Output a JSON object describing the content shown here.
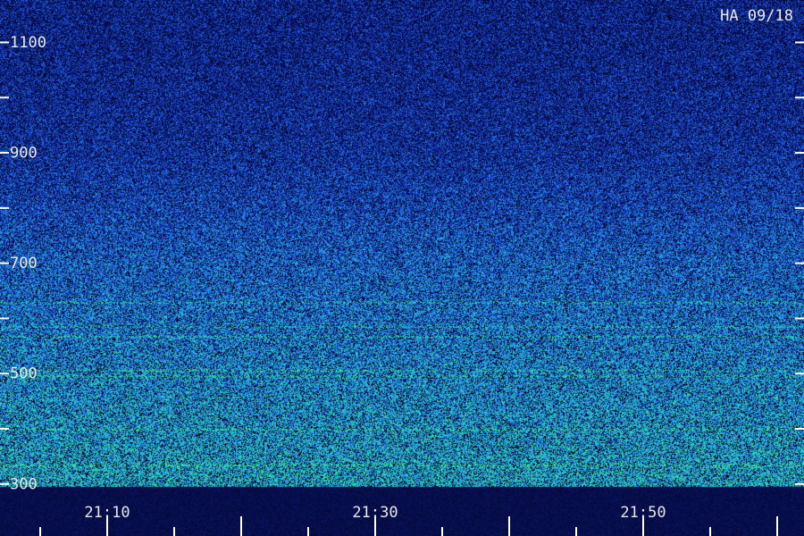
{
  "header": {
    "station_label": "HA 09/18"
  },
  "chart_data": {
    "type": "heatmap",
    "title": "",
    "xlabel": "",
    "ylabel": "",
    "x_tick_labels": [
      "21:10",
      "21:30",
      "21:50"
    ],
    "x_range": [
      "21:02",
      "22:02"
    ],
    "y_tick_labels": [
      1100,
      900,
      700,
      500,
      300
    ],
    "y_range": [
      294,
      1176
    ],
    "colormap": [
      "#000014",
      "#0a1c88",
      "#1f4fd8",
      "#25a7e8",
      "#2fe39a",
      "#56f25a"
    ],
    "intensity_profile": {
      "description_levels": [
        {
          "y": 1100,
          "level": 0.26
        },
        {
          "y": 900,
          "level": 0.32
        },
        {
          "y": 700,
          "level": 0.48
        },
        {
          "y": 500,
          "level": 0.58
        },
        {
          "y": 300,
          "level": 0.66
        }
      ]
    },
    "grid": false,
    "legend": "none"
  }
}
